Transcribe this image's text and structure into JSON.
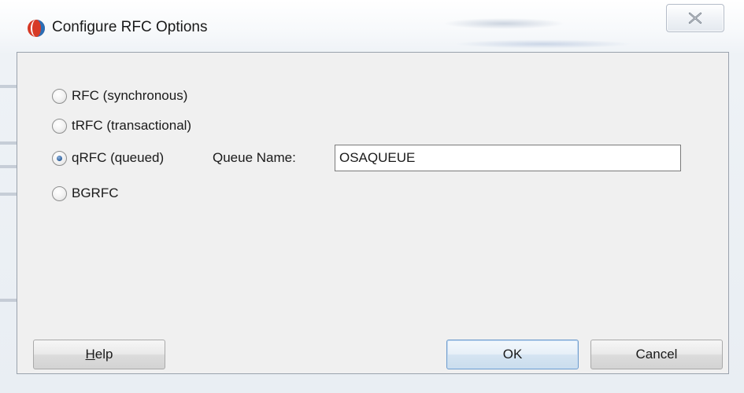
{
  "window": {
    "title": "Configure RFC Options",
    "icon": "oracle-app-icon",
    "close_icon": "close-icon"
  },
  "options": [
    {
      "label": "RFC (synchronous)",
      "checked": false
    },
    {
      "label": "tRFC (transactional)",
      "checked": false
    },
    {
      "label": "qRFC (queued)",
      "checked": true
    },
    {
      "label": "BGRFC",
      "checked": false
    }
  ],
  "queue": {
    "label": "Queue Name:",
    "value": "OSAQUEUE"
  },
  "buttons": {
    "help_mnemonic": "H",
    "help_rest": "elp",
    "ok": "OK",
    "cancel": "Cancel"
  },
  "colors": {
    "accent": "#2b5d99",
    "icon_red": "#d73a26",
    "icon_blue": "#2a6fb6"
  }
}
